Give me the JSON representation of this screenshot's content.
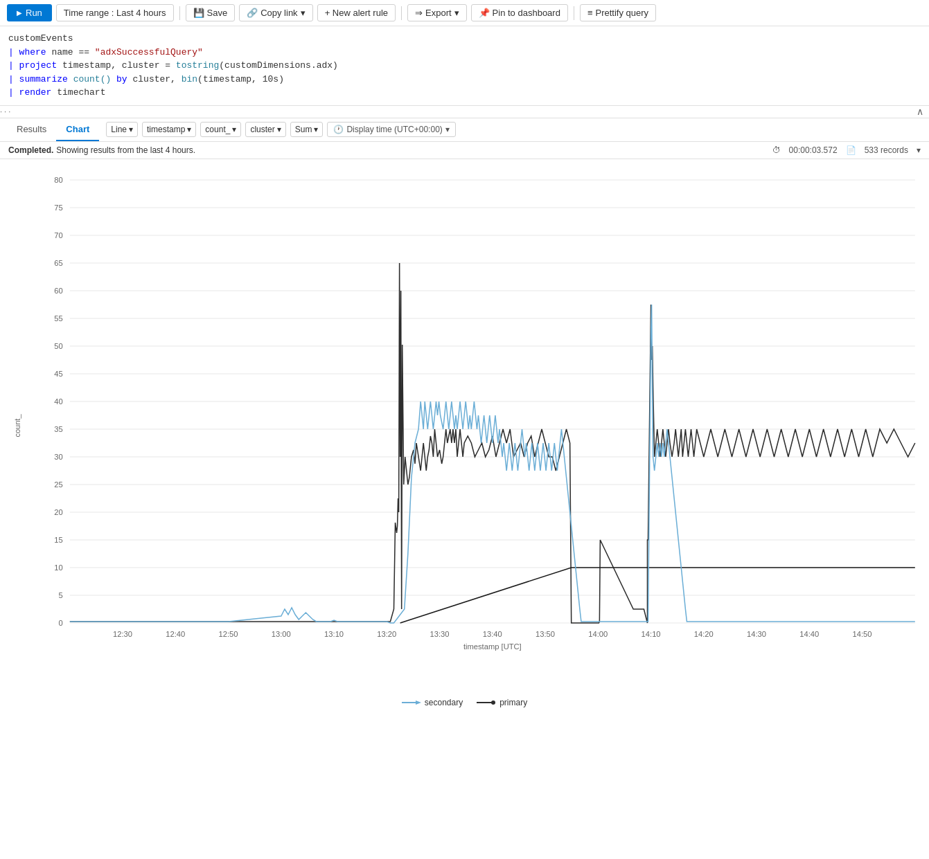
{
  "toolbar": {
    "run_label": "Run",
    "time_range_label": "Time range : Last 4 hours",
    "save_label": "Save",
    "copy_link_label": "Copy link",
    "new_alert_label": "+ New alert rule",
    "export_label": "Export",
    "pin_dashboard_label": "Pin to dashboard",
    "prettify_label": "Prettify query"
  },
  "query": {
    "lines": [
      {
        "text": "customEvents",
        "color": "default"
      },
      {
        "text": "| where name == \"adxSuccessfulQuery\"",
        "color": "mixed"
      },
      {
        "text": "| project timestamp, cluster = tostring(customDimensions.adx)",
        "color": "mixed"
      },
      {
        "text": "| summarize count() by cluster, bin(timestamp, 10s)",
        "color": "mixed"
      },
      {
        "text": "| render timechart",
        "color": "mixed"
      }
    ]
  },
  "tabs": {
    "results_label": "Results",
    "chart_label": "Chart",
    "active": "Chart"
  },
  "chart_options": {
    "type_label": "Line",
    "x_label": "timestamp",
    "y_label": "count_",
    "group_label": "cluster",
    "agg_label": "Sum",
    "time_display": "Display time (UTC+00:00)"
  },
  "status": {
    "completed_label": "Completed.",
    "message": "Showing results from the last 4 hours.",
    "duration": "00:00:03.572",
    "records": "533 records"
  },
  "chart": {
    "y_axis_label": "count_",
    "x_label": "timestamp [UTC]",
    "y_ticks": [
      "80",
      "75",
      "70",
      "65",
      "60",
      "55",
      "50",
      "45",
      "40",
      "35",
      "30",
      "25",
      "20",
      "15",
      "10",
      "5",
      "0"
    ],
    "x_ticks": [
      "12:30",
      "12:40",
      "12:50",
      "13:00",
      "13:10",
      "13:20",
      "13:30",
      "13:40",
      "13:50",
      "14:00",
      "14:10",
      "14:20",
      "14:30",
      "14:40",
      "14:50"
    ]
  },
  "legend": {
    "secondary_label": "secondary",
    "primary_label": "primary"
  },
  "colors": {
    "primary_line": "#2d2d2d",
    "secondary_line": "#6baed6",
    "accent": "#0078d4",
    "grid": "#e8e8e8"
  }
}
